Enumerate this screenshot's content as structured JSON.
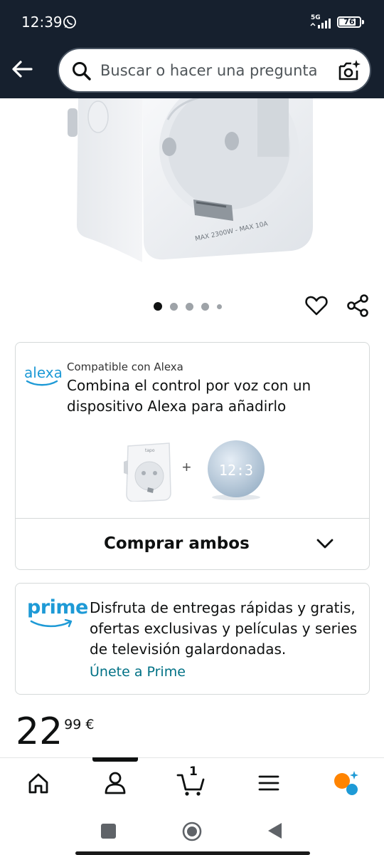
{
  "status_bar": {
    "time": "12:39",
    "network": "5G",
    "battery": "76",
    "battery_level": 0.76,
    "icons": [
      "whatsapp-icon",
      "signal-icon",
      "battery-icon"
    ]
  },
  "header": {
    "search_placeholder": "Buscar o hacer una pregunta",
    "icons": [
      "back-arrow-icon",
      "search-icon",
      "camera-icon"
    ]
  },
  "gallery": {
    "image": "smart-plug-photo",
    "image_text": "MAX 2300W - MAX 10A",
    "image_count": 5,
    "active_index": 0,
    "icons": [
      "heart-icon",
      "share-icon"
    ]
  },
  "alexa_card": {
    "logo": "alexa",
    "small_label": "Compatible con Alexa",
    "description": "Combina el control por voz con un dispositivo Alexa para añadirlo",
    "plug_brand": "tapo",
    "plus": "+",
    "echo_display": "12:3",
    "buy_both_label": "Comprar ambos"
  },
  "prime_card": {
    "logo": "prime",
    "text": "Disfruta de entregas rápidas y gratis, ofertas exclusivas y películas y series de televisión galardonadas.",
    "link": "Únete a Prime"
  },
  "price": {
    "whole": "22",
    "fraction_currency": "99 €"
  },
  "bottom_nav": {
    "items": [
      "home-icon",
      "account-icon",
      "cart-icon",
      "menu-icon",
      "rufus-icon"
    ],
    "active_item": "account-icon",
    "cart_count": "1",
    "accent_color": "#ff8400",
    "secondary_color": "#1e9ad6"
  },
  "system_nav": {
    "items": [
      "recent-apps-button",
      "home-button",
      "back-button"
    ]
  },
  "colors": {
    "header_bg": "#16202e",
    "link": "#007185",
    "alexa_blue": "#1e9ad6"
  }
}
